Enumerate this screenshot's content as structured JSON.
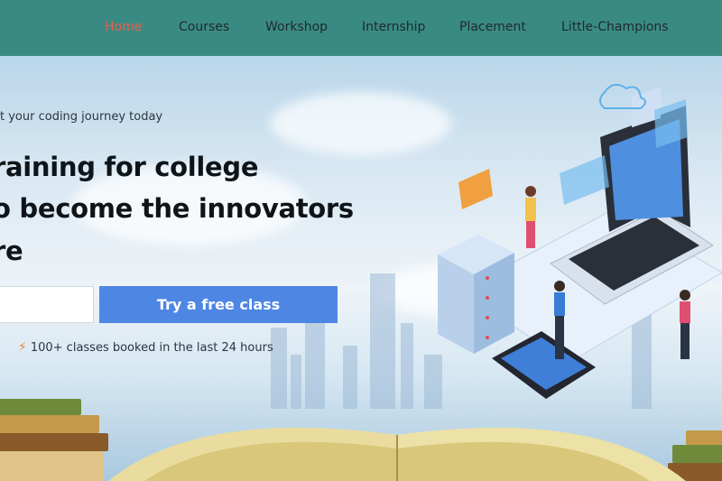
{
  "nav": {
    "items": [
      {
        "label": "Home",
        "active": true
      },
      {
        "label": "Courses",
        "active": false
      },
      {
        "label": "Workshop",
        "active": false
      },
      {
        "label": "Internship",
        "active": false
      },
      {
        "label": "Placement",
        "active": false
      },
      {
        "label": "Little-Champions",
        "active": false
      }
    ]
  },
  "hero": {
    "tagline": "t your coding journey today",
    "headline_lines": [
      "raining for college",
      "o become the innovators",
      "re"
    ],
    "cta_label": "Try a free class",
    "booked_icon": "lightning-icon",
    "booked_text": "100+ classes booked in the last 24 hours"
  },
  "colors": {
    "nav_bg": "#3a8a84",
    "nav_active": "#e8604c",
    "cta_bg": "#4e86e4",
    "bolt": "#e88a2a"
  }
}
